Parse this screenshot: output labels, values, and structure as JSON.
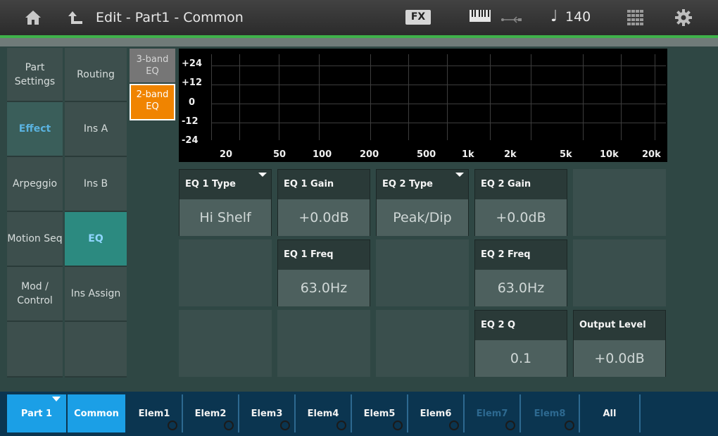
{
  "header": {
    "title": "Edit - Part1 - Common",
    "fx_label": "FX",
    "tempo": "140",
    "tempo_note_glyph": "♩",
    "icons": [
      "home-icon",
      "back-icon",
      "keyboard-icon",
      "usb-icon",
      "quarter-note-icon",
      "grid-icon",
      "gear-icon"
    ]
  },
  "nav_left": [
    {
      "label": "Part Settings",
      "active": false
    },
    {
      "label": "Effect",
      "active": true
    },
    {
      "label": "Arpeggio",
      "active": false
    },
    {
      "label": "Motion Seq",
      "active": false
    },
    {
      "label": "Mod / Control",
      "active": false
    }
  ],
  "nav_sub": [
    {
      "label": "Routing",
      "active": false
    },
    {
      "label": "Ins A",
      "active": false
    },
    {
      "label": "Ins B",
      "active": false
    },
    {
      "label": "EQ",
      "active": true
    },
    {
      "label": "Ins Assign",
      "active": false
    }
  ],
  "eq_band": {
    "option_3": "3-band EQ",
    "option_2": "2-band EQ",
    "selected": "2-band EQ"
  },
  "graph": {
    "y_labels": [
      "+24",
      "+12",
      "0",
      "-12",
      "-24"
    ],
    "x_labels": [
      "20",
      "50",
      "100",
      "200",
      "500",
      "1k",
      "2k",
      "5k",
      "10k",
      "20k"
    ]
  },
  "params": {
    "eq1_type": {
      "label": "EQ 1 Type",
      "value": "Hi Shelf"
    },
    "eq1_gain": {
      "label": "EQ 1 Gain",
      "value": "+0.0dB"
    },
    "eq2_type": {
      "label": "EQ 2 Type",
      "value": "Peak/Dip"
    },
    "eq2_gain": {
      "label": "EQ 2 Gain",
      "value": "+0.0dB"
    },
    "eq1_freq": {
      "label": "EQ 1 Freq",
      "value": "63.0Hz"
    },
    "eq2_freq": {
      "label": "EQ 2 Freq",
      "value": "63.0Hz"
    },
    "eq2_q": {
      "label": "EQ 2 Q",
      "value": "0.1"
    },
    "output_level": {
      "label": "Output Level",
      "value": "+0.0dB"
    }
  },
  "bottom": {
    "part": "Part 1",
    "common": "Common",
    "elements": [
      {
        "label": "Elem1",
        "enabled": true
      },
      {
        "label": "Elem2",
        "enabled": true
      },
      {
        "label": "Elem3",
        "enabled": true
      },
      {
        "label": "Elem4",
        "enabled": true
      },
      {
        "label": "Elem5",
        "enabled": true
      },
      {
        "label": "Elem6",
        "enabled": true
      },
      {
        "label": "Elem7",
        "enabled": false
      },
      {
        "label": "Elem8",
        "enabled": false
      }
    ],
    "all": "All"
  },
  "colors": {
    "accent_green": "#3fb24a",
    "selected_orange": "#f08400",
    "selected_blue": "#1b9fe6",
    "active_text_blue": "#5ab3e0"
  }
}
